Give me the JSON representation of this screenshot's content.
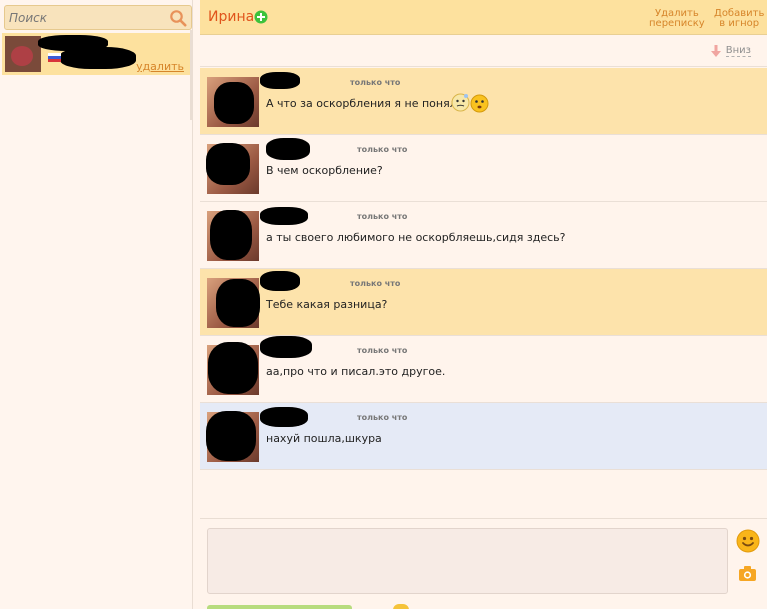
{
  "sidebar": {
    "search": {
      "placeholder": "Поиск"
    },
    "contacts": [
      {
        "delete_label": "удалить"
      }
    ]
  },
  "header": {
    "contact_name": "Ирина",
    "delete_conversation": [
      "Удалить",
      "переписку"
    ],
    "add_to_ignore": [
      "Добавить",
      "в игнор"
    ]
  },
  "toolbar": {
    "down_label": "Вниз"
  },
  "messages": [
    {
      "time": "только что",
      "text": "А что за оскорбления я не поняла",
      "style": "yellow",
      "emoji": [
        "thinking-face-icon",
        "flushed-face-icon"
      ]
    },
    {
      "time": "только что",
      "text": "В чем оскорбление?",
      "style": "plain"
    },
    {
      "time": "только что",
      "text": "а ты своего любимого не оскорбляешь,сидя здесь?",
      "style": "plain"
    },
    {
      "time": "только что",
      "text": "Тебе какая разница?",
      "style": "yellow"
    },
    {
      "time": "только что",
      "text": "аа,про что и писал.это другое.",
      "style": "plain"
    },
    {
      "time": "только что",
      "text": "нахуй пошла,шкура",
      "style": "blue"
    }
  ],
  "composer": {
    "value": ""
  },
  "colors": {
    "accent": "#e0541c",
    "link": "#d6852a",
    "header_bg": "#fde19e",
    "incoming_bg": "#fde3ab",
    "selected_bg": "#e5eaf6"
  }
}
